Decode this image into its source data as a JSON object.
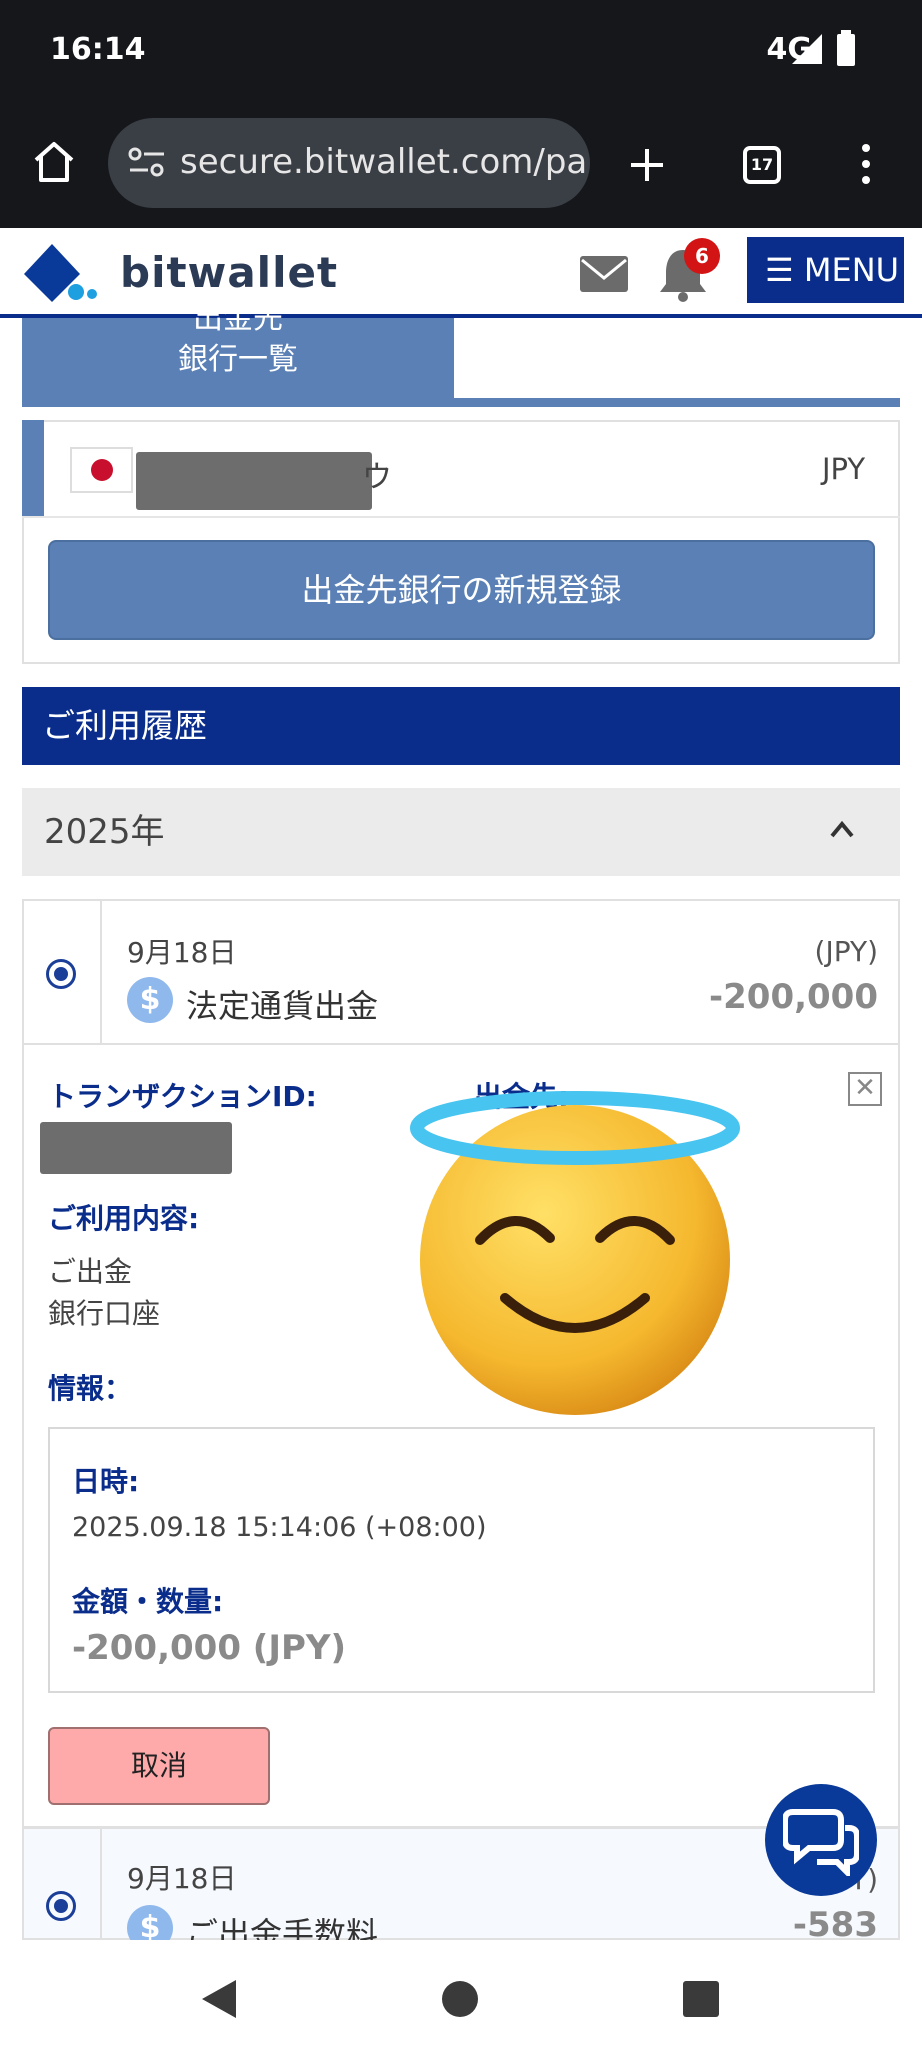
{
  "status_bar": {
    "time": "16:14",
    "network": "4G"
  },
  "browser": {
    "url": "secure.bitwallet.com/pa",
    "tab_count": "17"
  },
  "header": {
    "logo": "bitwallet",
    "notification_count": "6",
    "menu_label": "MENU"
  },
  "bank_section": {
    "tab_label_line1": "出金先",
    "tab_label_line2": "銀行一覧",
    "bank_name_suffix": "ウ",
    "bank_currency": "JPY",
    "register_button": "出金先銀行の新規登録"
  },
  "history": {
    "title": "ご利用履歴",
    "year": "2025年",
    "transactions": [
      {
        "date": "9月18日",
        "type": "法定通貨出金",
        "currency": "(JPY)",
        "amount": "-200,000"
      },
      {
        "date": "9月18日",
        "type": "ご出金手数料",
        "currency": "(JPY)",
        "amount": "-583"
      }
    ],
    "detail": {
      "transaction_id_label": "トランザクションID:",
      "destination_label": "出金先:",
      "usage_label": "ご利用内容:",
      "usage_line1": "ご出金",
      "usage_line2": "銀行口座",
      "info_label": "情報：",
      "datetime_label": "日時:",
      "datetime_value": "2025.09.18 15:14:06 (+08:00)",
      "amount_label": "金額・数量:",
      "amount_value": "-200,000 (JPY)",
      "cancel_button": "取消"
    }
  },
  "colors": {
    "brand_navy": "#0a2d8c",
    "tab_blue": "#5a80b6",
    "cancel_pink": "#ffaaaa"
  }
}
